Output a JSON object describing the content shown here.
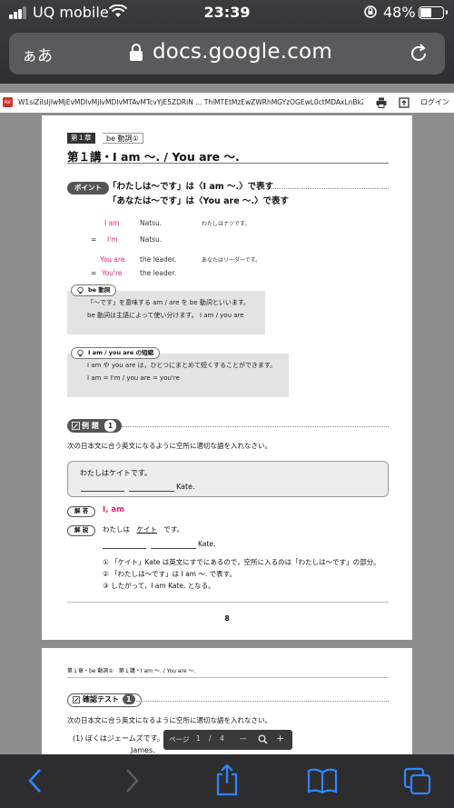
{
  "status_bar": {
    "carrier": "UQ mobile",
    "time": "23:39",
    "battery_percent": "48%"
  },
  "safari": {
    "text_size_button": "ぁあ",
    "url": "docs.google.com"
  },
  "pdf_toolbar": {
    "file_name": "W1siZiIsIjIwMjEvMDIvMjIvMDIvMTAvMTcvYjE5ZDRiN ... ThiMTEtMzEwZWRhMGYzOGEwL0ctMDAxLnBkZiJdXQ.pdf",
    "login_label": "ログイン"
  },
  "page1": {
    "chapter_tag": "第１章",
    "chapter_subtitle": "be 動詞①",
    "lesson_title": "第１講・I am 〜. / You are 〜.",
    "point_pill": "ポイント",
    "point_line1": "「わたしは〜です」は〈I am 〜.〉で表す",
    "point_line2": "「あなたは〜です」は〈You are 〜.〉で表す",
    "examples": [
      {
        "prefix": "",
        "subject": "I am",
        "rest": "Natsu.",
        "translation": "わたしはナツです。"
      },
      {
        "prefix": "=",
        "subject": "I'm",
        "rest": "Natsu.",
        "translation": ""
      },
      {
        "prefix": "",
        "subject": "You are",
        "rest": "the leader.",
        "translation": "あなたはリーダーです。"
      },
      {
        "prefix": "=",
        "subject": "You're",
        "rest": "the leader.",
        "translation": ""
      }
    ],
    "note1": {
      "heading": "be 動詞",
      "line1": "「〜です」を意味する am / are を be 動詞といいます。",
      "line2": "be 動詞は主語によって使い分けます。 I am / you are"
    },
    "note2": {
      "heading": "I am / you are の短縮",
      "line1": "I am や you are は，ひとつにまとめて短くすることができます。",
      "line2": "I am = I'm / you are = you're"
    },
    "example_pill": "例 題",
    "example_number": "1",
    "instruction": "次の日本文に合う英文になるように空所に適切な語を入れなさい。",
    "question_japanese": "わたしはケイトです。",
    "question_english_tail": "Kate.",
    "answer_pill": "解 答",
    "answer": "I, am",
    "explanation_pill": "解 説",
    "explanation_head_pre": "わたしは",
    "explanation_head_word": "ケイト",
    "explanation_head_post": "です。",
    "explanation_tail": "Kate.",
    "explanation_points": [
      "① 「ケイト」Kate は英文にすでにあるので，空所に入るのは「わたしは〜です」の部分。",
      "② 「わたしは〜です」は I am 〜. で表す。",
      "③ したがって，I am Kate. となる。"
    ],
    "page_number": "8"
  },
  "page2": {
    "header": "第１章・be 動詞①　第１講・I am 〜. / You are 〜.",
    "test_pill": "確認テスト",
    "test_number": "1",
    "instruction": "次の日本文に合う英文になるように空所に適切な語を入れなさい。",
    "q1": "(1) ぼくはジェームズです。",
    "q1_tail": "James."
  },
  "page_control": {
    "label": "ページ",
    "current": "1",
    "separator": "/",
    "total": "4",
    "zoom_out": "—",
    "zoom_in": "+"
  }
}
